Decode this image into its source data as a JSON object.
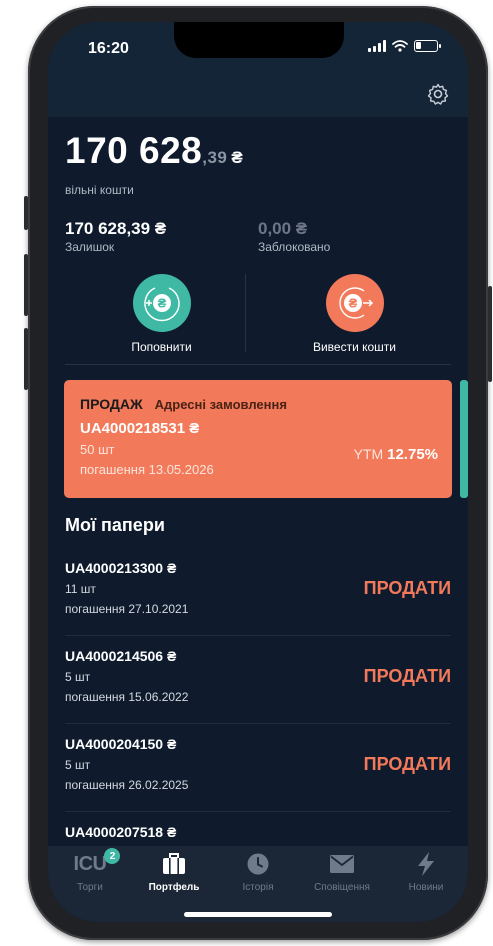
{
  "status": {
    "time": "16:20"
  },
  "balance": {
    "integer": "170 628",
    "cents": ",39",
    "currency": "₴",
    "label": "вільні кошти"
  },
  "subtotals": {
    "remaining": {
      "value": "170 628,39 ₴",
      "label": "Залишок"
    },
    "blocked": {
      "value": "0,00 ₴",
      "label": "Заблоковано"
    }
  },
  "actions": {
    "deposit": "Поповнити",
    "withdraw": "Вивести кошти"
  },
  "order": {
    "type": "ПРОДАЖ",
    "kind": "Адресні замовлення",
    "code": "UA4000218531 ₴",
    "qty": "50 шт",
    "maturity": "погашення 13.05.2026",
    "ytm_label": "YTM",
    "ytm_value": "12.75%"
  },
  "section_title": "Мої папери",
  "papers": [
    {
      "code": "UA4000213300 ₴",
      "qty": "11 шт",
      "maturity": "погашення 27.10.2021",
      "action": "ПРОДАТИ"
    },
    {
      "code": "UA4000214506 ₴",
      "qty": "5 шт",
      "maturity": "погашення 15.06.2022",
      "action": "ПРОДАТИ"
    },
    {
      "code": "UA4000204150 ₴",
      "qty": "5 шт",
      "maturity": "погашення 26.02.2025",
      "action": "ПРОДАТИ"
    },
    {
      "code": "UA4000207518 ₴",
      "qty": "",
      "maturity": "",
      "action": ""
    }
  ],
  "tabs": [
    {
      "label": "Торги",
      "icon": "icu-logo-icon",
      "icon_text": "ICU",
      "badge": "2"
    },
    {
      "label": "Портфель",
      "icon": "briefcase-icon"
    },
    {
      "label": "Історія",
      "icon": "clock-icon"
    },
    {
      "label": "Сповіщення",
      "icon": "envelope-icon"
    },
    {
      "label": "Новини",
      "icon": "lightning-icon"
    }
  ],
  "colors": {
    "accent": "#f27a5a",
    "teal": "#3fb9a4",
    "background": "#0f1b2d"
  }
}
